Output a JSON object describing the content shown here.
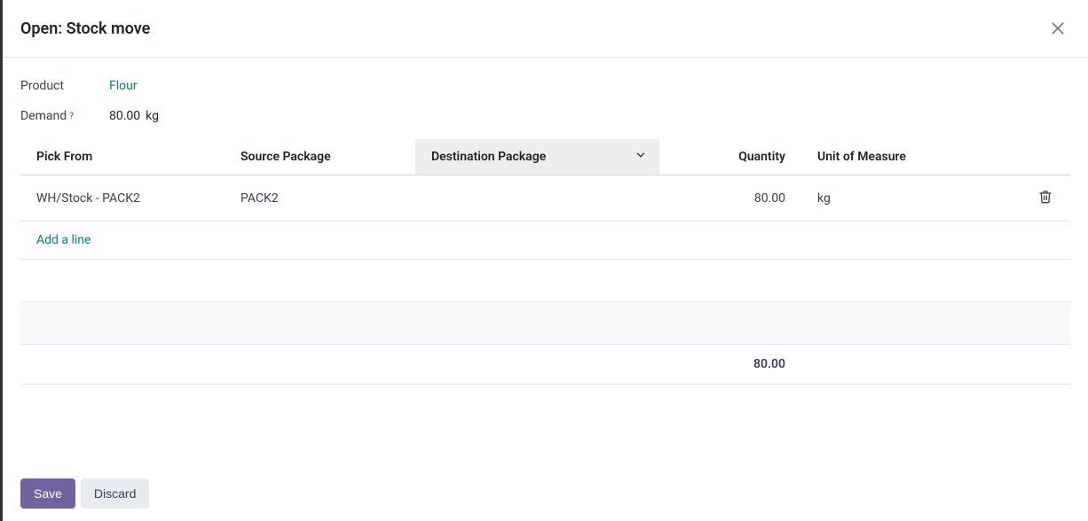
{
  "header": {
    "title": "Open: Stock move"
  },
  "fields": {
    "product_label": "Product",
    "product_value": "Flour",
    "demand_label": "Demand",
    "demand_value": "80.00",
    "demand_unit": "kg"
  },
  "table": {
    "columns": {
      "pick_from": "Pick From",
      "source_package": "Source Package",
      "destination_package": "Destination Package",
      "quantity": "Quantity",
      "uom": "Unit of Measure"
    },
    "rows": [
      {
        "pick_from": "WH/Stock - PACK2",
        "source_package": "PACK2",
        "destination_package": "",
        "quantity": "80.00",
        "uom": "kg"
      }
    ],
    "add_line": "Add a line",
    "total_quantity": "80.00"
  },
  "footer": {
    "save": "Save",
    "discard": "Discard"
  }
}
